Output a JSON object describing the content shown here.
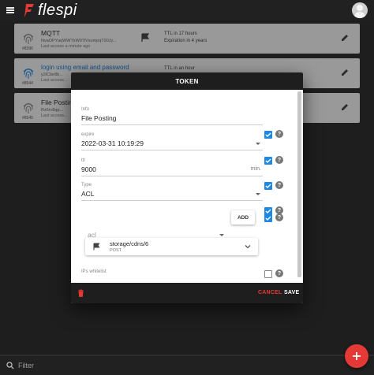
{
  "appbar": {
    "logo_text": "flespi"
  },
  "tokens": [
    {
      "id": "#8396",
      "title": "MQTT",
      "key": "NvaOPYaqWWTkW07iVsumpqT00Jy...",
      "access": "Last access a minute ago",
      "ttl": "TTL in 17 hours",
      "expiration": "Expiration in 4 years",
      "title_style": "normal"
    },
    {
      "id": "#8544",
      "title": "login using email and password",
      "key": "y2lCbe8b...",
      "access": "Last access...",
      "ttl": "TTL in an hour",
      "expiration": "",
      "title_style": "link"
    },
    {
      "id": "#8545",
      "title": "File Posting",
      "key": "Rz6rv8qp...",
      "access": "Last access...",
      "ttl": "",
      "expiration": "",
      "title_style": "normal"
    }
  ],
  "dialog": {
    "title": "TOKEN",
    "info": {
      "label": "Info",
      "value": "File Posting",
      "checked": true
    },
    "expire": {
      "label": "expire",
      "value": "2022-03-31 10:19:29",
      "checked": true
    },
    "ttl": {
      "label": "ttl",
      "value": "9000",
      "suffix": "min.",
      "checked": true
    },
    "type": {
      "label": "Type",
      "value": "ACL",
      "checked": true
    },
    "acl": {
      "placeholder": "acl",
      "add_label": "ADD",
      "checked": true
    },
    "acl_items": [
      {
        "topic": "storage/cdns/6",
        "method": "POST"
      }
    ],
    "ips": {
      "label": "IPs whitelist",
      "checked": false
    },
    "help_glyph": "?",
    "cancel_label": "CANCEL",
    "save_label": "SAVE"
  },
  "filter": {
    "placeholder": "Filter"
  },
  "colors": {
    "accent": "#e53935",
    "check": "#1e88e5",
    "link": "#1f7bd1"
  },
  "icons": [
    "menu-icon",
    "flespi-logo",
    "avatar",
    "fingerprint-icon",
    "flag-icon",
    "ttl-clock-icon",
    "edit-icon",
    "help-icon",
    "delete-icon",
    "chevron-down-icon",
    "search-icon",
    "add-icon"
  ]
}
